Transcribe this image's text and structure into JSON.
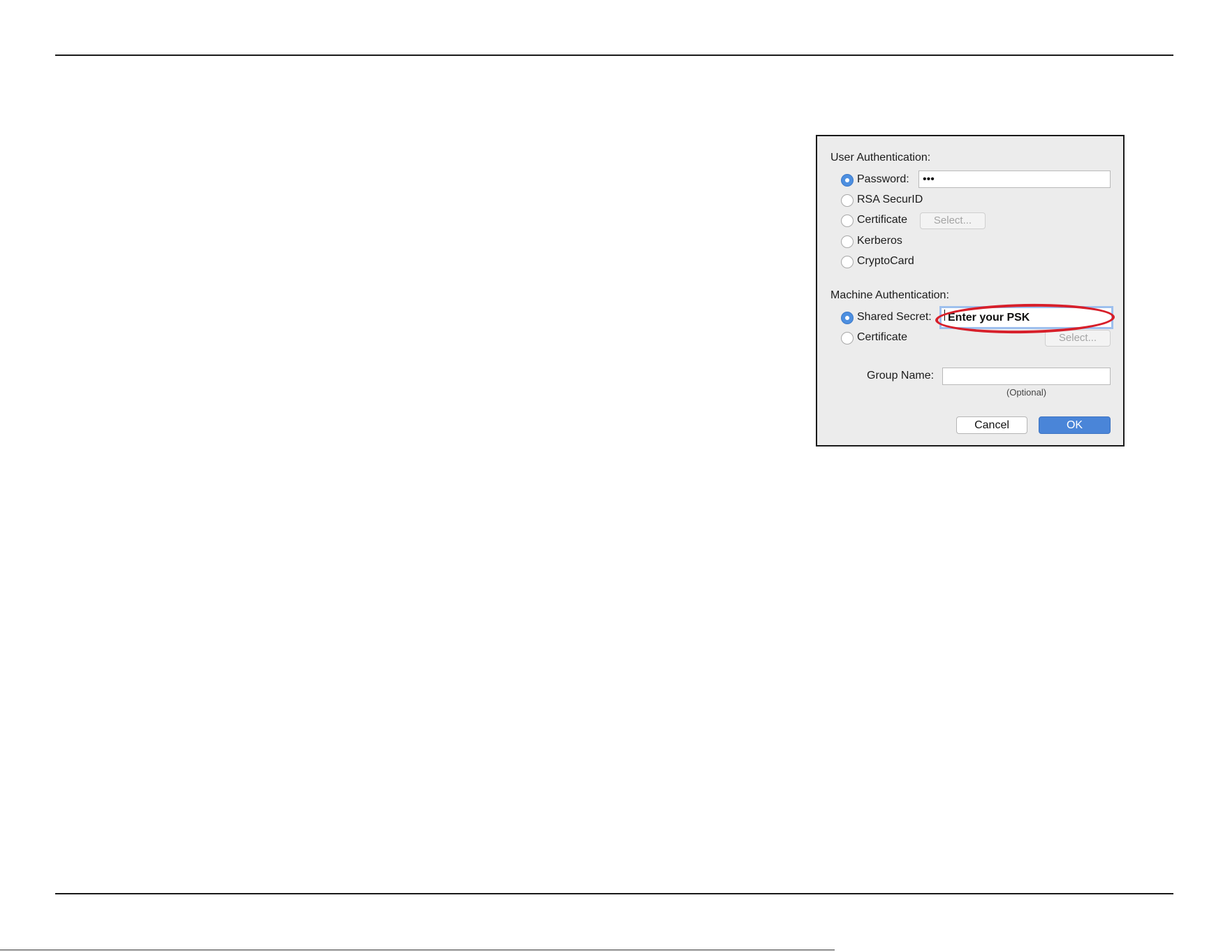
{
  "user_auth": {
    "heading": "User Authentication:",
    "options": [
      {
        "label": "Password:",
        "selected": true
      },
      {
        "label": "RSA SecurID",
        "selected": false
      },
      {
        "label": "Certificate",
        "selected": false
      },
      {
        "label": "Kerberos",
        "selected": false
      },
      {
        "label": "CryptoCard",
        "selected": false
      }
    ],
    "password_value": "•••",
    "select_label": "Select..."
  },
  "machine_auth": {
    "heading": "Machine Authentication:",
    "options": [
      {
        "label": "Shared Secret:",
        "selected": true
      },
      {
        "label": "Certificate",
        "selected": false
      }
    ],
    "shared_secret_value": "Enter your PSK",
    "select_label": "Select..."
  },
  "group": {
    "label": "Group Name:",
    "value": "",
    "hint": "(Optional)"
  },
  "buttons": {
    "cancel": "Cancel",
    "ok": "OK"
  },
  "colors": {
    "accent": "#4a85d8",
    "annotation": "#d71f2a",
    "dialog_bg": "#ececec"
  }
}
